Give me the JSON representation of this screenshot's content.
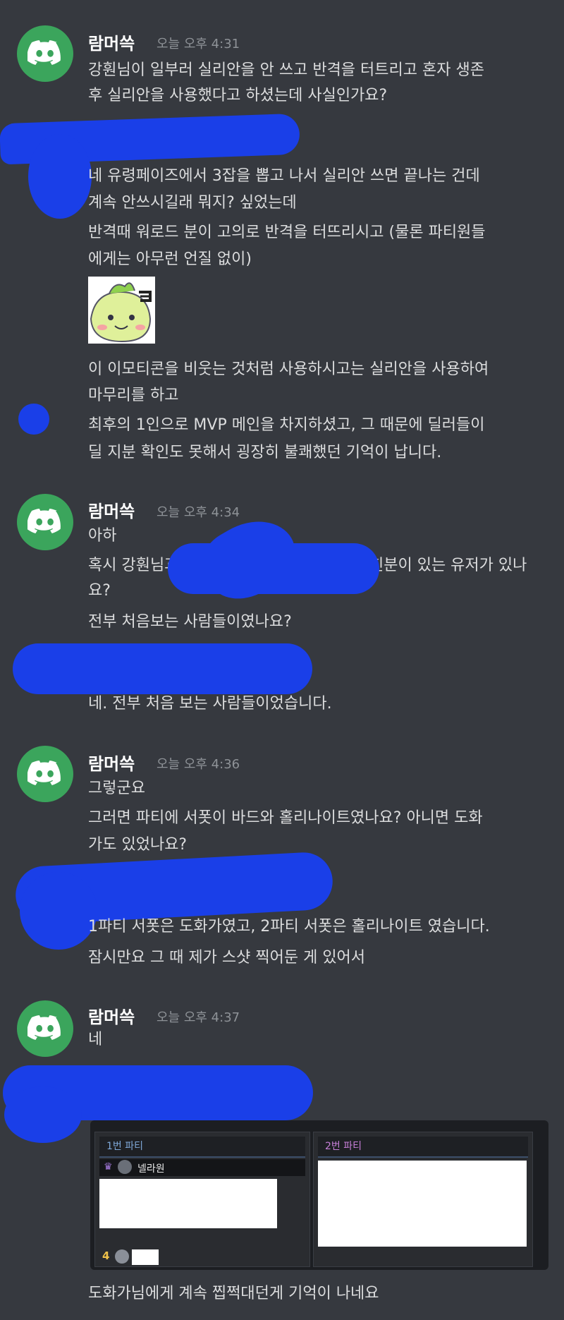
{
  "messages": [
    {
      "username": "람머쓱",
      "timestamp": "오늘 오후 4:31",
      "lines": [
        "강훤님이 일부러 실리안을 안 쓰고 반격을 터트리고 혼자 생존",
        "후 실리안을 사용했다고 하셨는데 사실인가요?"
      ]
    },
    {
      "username": "",
      "timestamp": "",
      "lines": [
        "네 유령페이즈에서 3잡을 뽑고 나서 실리안 쓰면 끝나는 건데",
        "계속 안쓰시길래 뭐지? 싶었는데",
        "반격때 워로드 분이 고의로 반격을 터뜨리시고 (물론 파티원들",
        "에게는 아무런 언질 없이)",
        "이 이모티콘을 비웃는 것처럼 사용하시고는 실리안을 사용하여",
        "마무리를 하고",
        "최후의 1인으로 MVP 메인을 차지하셨고, 그 때문에 딜러들이",
        "딜 지분 확인도 못해서 굉장히 불쾌했던 기억이 납니다."
      ]
    },
    {
      "username": "람머쓱",
      "timestamp": "오늘 오후 4:34",
      "lines": [
        "아하",
        "혹시 강훤님과",
        "친분이 있는 유저가 있나",
        "요?",
        "전부 처음보는 사람들이였나요?"
      ]
    },
    {
      "username": "",
      "timestamp": "",
      "lines": [
        "네. 전부 처음 보는 사람들이었습니다."
      ]
    },
    {
      "username": "람머쓱",
      "timestamp": "오늘 오후 4:36",
      "lines": [
        "그렇군요",
        "그러면 파티에 서폿이 바드와 홀리나이트였나요? 아니면 도화",
        "가도 있었나요?"
      ]
    },
    {
      "username": "",
      "timestamp": "",
      "lines": [
        "1파티 서폿은 도화가였고, 2파티 서폿은 홀리나이트 였습니다.",
        "잠시만요 그 때 제가 스샷 찍어둔 게 있어서"
      ]
    },
    {
      "username": "람머쓱",
      "timestamp": "오늘 오후 4:37",
      "lines": [
        "네"
      ]
    },
    {
      "username": "",
      "timestamp": "",
      "lines": [
        "도화가님에게 계속 찝쩍대던게 기억이 나네요"
      ]
    }
  ],
  "embed": {
    "party1_label": "1번 파티",
    "party2_label": "2번 파티",
    "party1_player": "넬라원",
    "party1_slot_number": "4"
  },
  "colors": {
    "background": "#36393f",
    "avatar": "#3ba55c",
    "redaction": "#1a3fe8",
    "party1_label": "#7fa8d8",
    "party2_label": "#c77fd8"
  },
  "icons": [
    "discord-logo-icon",
    "crown-icon",
    "class-emblem-icon",
    "emoticon-image"
  ]
}
